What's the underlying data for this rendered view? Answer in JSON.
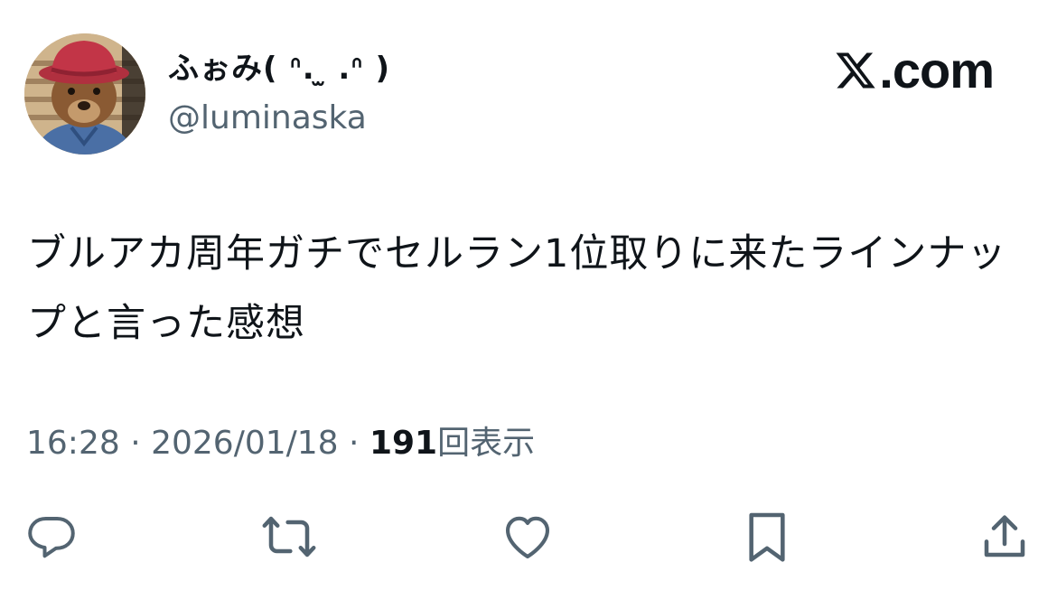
{
  "author": {
    "display_name": "ふぉみ( ᐢ. ̫ .ᐢ )",
    "handle": "@luminaska",
    "avatar": "bear-avatar"
  },
  "brand": {
    "text": ".com",
    "icon": "x-logo-icon"
  },
  "tweet": {
    "text": "ブルアカ周年ガチでセルラン1位取りに来たラインナップと言った感想"
  },
  "meta": {
    "time": "16:28",
    "sep1": " · ",
    "date": "2026/01/18",
    "sep2": " · ",
    "views_count": "191",
    "views_label": "回表示"
  },
  "actions": [
    {
      "icon": "reply-icon"
    },
    {
      "icon": "retweet-icon"
    },
    {
      "icon": "like-icon"
    },
    {
      "icon": "bookmark-icon"
    },
    {
      "icon": "share-icon"
    }
  ],
  "colors": {
    "text_primary": "#0f1419",
    "text_secondary": "#536471"
  }
}
